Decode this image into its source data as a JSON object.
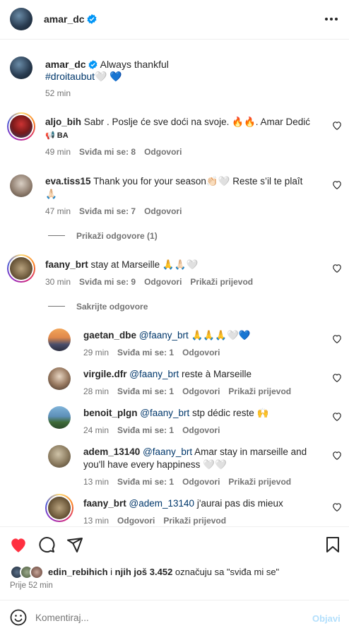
{
  "post": {
    "author": "amar_dc",
    "caption": "Always thankful",
    "hashtag": "#droitaubut",
    "caption_emoji": "🤍 💙",
    "time": "52 min"
  },
  "labels": {
    "like": "Sviđa mi se:",
    "reply": "Odgovori",
    "see_translation": "Prikaži prijevod",
    "show_replies": "Prikaži odgovore (1)",
    "hide_replies": "Sakrijte odgovore"
  },
  "comments": [
    {
      "user": "aljo_bih",
      "text": "Sabr . Poslje će sve doći na svoje. 🔥🔥. Amar Dedić",
      "text2": "📢 BA",
      "time": "49 min",
      "likes": "Sviđa mi se: 8",
      "reply": "Odgovori"
    },
    {
      "user": "eva.tiss15",
      "text": "Thank you for your season👏🏻🤍 Reste s’il te plaît",
      "text2": "🙏🏻",
      "time": "47 min",
      "likes": "Sviđa mi se: 7",
      "reply": "Odgovori"
    },
    {
      "user": "faany_brt",
      "text": "stay at Marseille 🙏🙏🏻🤍",
      "time": "30 min",
      "likes": "Sviđa mi se: 9",
      "reply": "Odgovori",
      "translate": "Prikaži prijevod"
    }
  ],
  "replies": [
    {
      "user": "gaetan_dbe",
      "mention": "@faany_brt",
      "text": " 🙏🙏🙏🤍💙",
      "time": "29 min",
      "likes": "Sviđa mi se: 1",
      "reply": "Odgovori"
    },
    {
      "user": "virgile.dfr",
      "mention": "@faany_brt",
      "text": " reste à Marseille",
      "time": "28 min",
      "likes": "Sviđa mi se: 1",
      "reply": "Odgovori",
      "translate": "Prikaži prijevod"
    },
    {
      "user": "benoit_plgn",
      "mention": "@faany_brt",
      "text": " stp dédic reste 🙌",
      "time": "24 min",
      "likes": "Sviđa mi se: 1",
      "reply": "Odgovori"
    },
    {
      "user": "adem_13140",
      "mention": "@faany_brt",
      "text": " Amar stay in marseille and",
      "text2": "you'll have every happiness 🤍🤍",
      "time": "13 min",
      "likes": "Sviđa mi se: 1",
      "reply": "Odgovori",
      "translate": "Prikaži prijevod"
    },
    {
      "user": "faany_brt",
      "mention": "@adem_13140",
      "text": " j'aurai pas dis mieux",
      "time": "13 min",
      "reply": "Odgovori",
      "translate": "Prikaži prijevod"
    }
  ],
  "likes_summary": {
    "user": "edin_rebihich",
    "middle": " i ",
    "others": "njih još 3.452",
    "suffix": " označuju sa \"sviđa mi se\"",
    "time": "Prije 52 min"
  },
  "composer": {
    "placeholder": "Komentiraj...",
    "post_label": "Objavi"
  },
  "colors": {
    "like_red": "#ff3040",
    "verified_blue": "#0095f6",
    "link": "#00376b",
    "muted": "#737373"
  }
}
